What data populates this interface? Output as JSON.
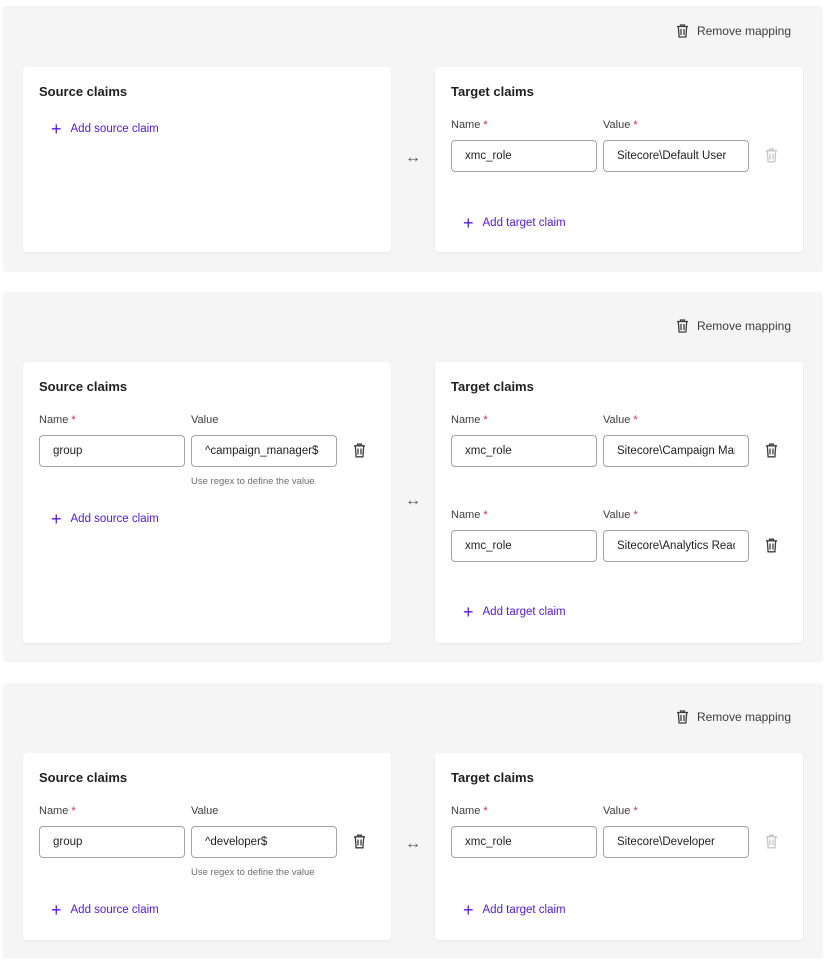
{
  "colors": {
    "accent": "#5319e7",
    "required": "#d92739",
    "panel": "#f5f5f5",
    "card": "#ffffff",
    "trash_enabled": "#3d3d3d",
    "trash_disabled": "#c7c7c7"
  },
  "labels": {
    "remove_mapping": "Remove mapping",
    "source_claims": "Source claims",
    "target_claims": "Target claims",
    "name": "Name",
    "value": "Value",
    "required_mark": "*",
    "add_source_claim": "Add source claim",
    "add_target_claim": "Add target claim",
    "regex_hint": "Use regex to define the value",
    "swap_icon": "↔"
  },
  "mappings": [
    {
      "source_claims": [],
      "target_claims": [
        {
          "name": "xmc_role",
          "value": "Sitecore\\Default User",
          "delete_enabled": false
        }
      ]
    },
    {
      "source_claims": [
        {
          "name": "group",
          "value": "^campaign_manager$"
        }
      ],
      "target_claims": [
        {
          "name": "xmc_role",
          "value": "Sitecore\\Campaign Manager",
          "delete_enabled": true
        },
        {
          "name": "xmc_role",
          "value": "Sitecore\\Analytics Reader",
          "delete_enabled": true
        }
      ]
    },
    {
      "source_claims": [
        {
          "name": "group",
          "value": "^developer$"
        }
      ],
      "target_claims": [
        {
          "name": "xmc_role",
          "value": "Sitecore\\Developer",
          "delete_enabled": false
        }
      ]
    }
  ]
}
